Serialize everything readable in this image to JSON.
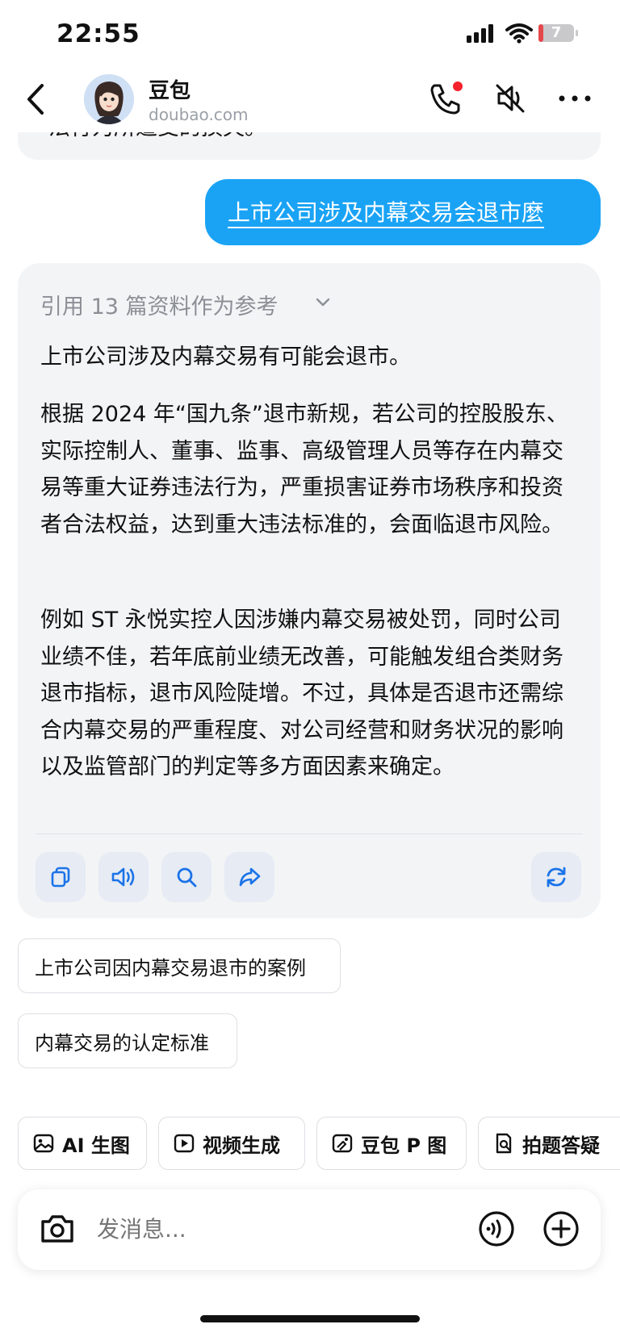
{
  "status_bar": {
    "time": "22:55",
    "battery": "7"
  },
  "header": {
    "name": "豆包",
    "domain": "doubao.com"
  },
  "previous_message": {
    "text": "法行为所遭受的损失。"
  },
  "user_message": {
    "text": "上市公司涉及内幕交易会退市麼"
  },
  "reply": {
    "references": "引用 13 篇资料作为参考",
    "paragraphs": [
      "上市公司涉及内幕交易有可能会退市。",
      "根据 2024 年“国九条”退市新规，若公司的控股股东、实际控制人、董事、监事、高级管理人员等存在内幕交易等重大证券违法行为，严重损害证券市场秩序和投资者合法权益，达到重大违法标准的，会面临退市风险。",
      "例如 ST 永悦实控人因涉嫌内幕交易被处罚，同时公司业绩不佳，若年底前业绩无改善，可能触发组合类财务退市指标，退市风险陡增。不过，具体是否退市还需综合内幕交易的严重程度、对公司经营和财务状况的影响以及监管部门的判定等多方面因素来确定。"
    ]
  },
  "suggestions": [
    "上市公司因内幕交易退市的案例",
    "内幕交易的认定标准"
  ],
  "tools": [
    "AI 生图",
    "视频生成",
    "豆包 P 图",
    "拍题答疑"
  ],
  "input": {
    "placeholder": "发消息..."
  },
  "colors": {
    "accent": "#1aa3f5",
    "card_bg": "#f3f4f6",
    "icon_blue": "#1a73e8",
    "notify_red": "#f5222d"
  }
}
